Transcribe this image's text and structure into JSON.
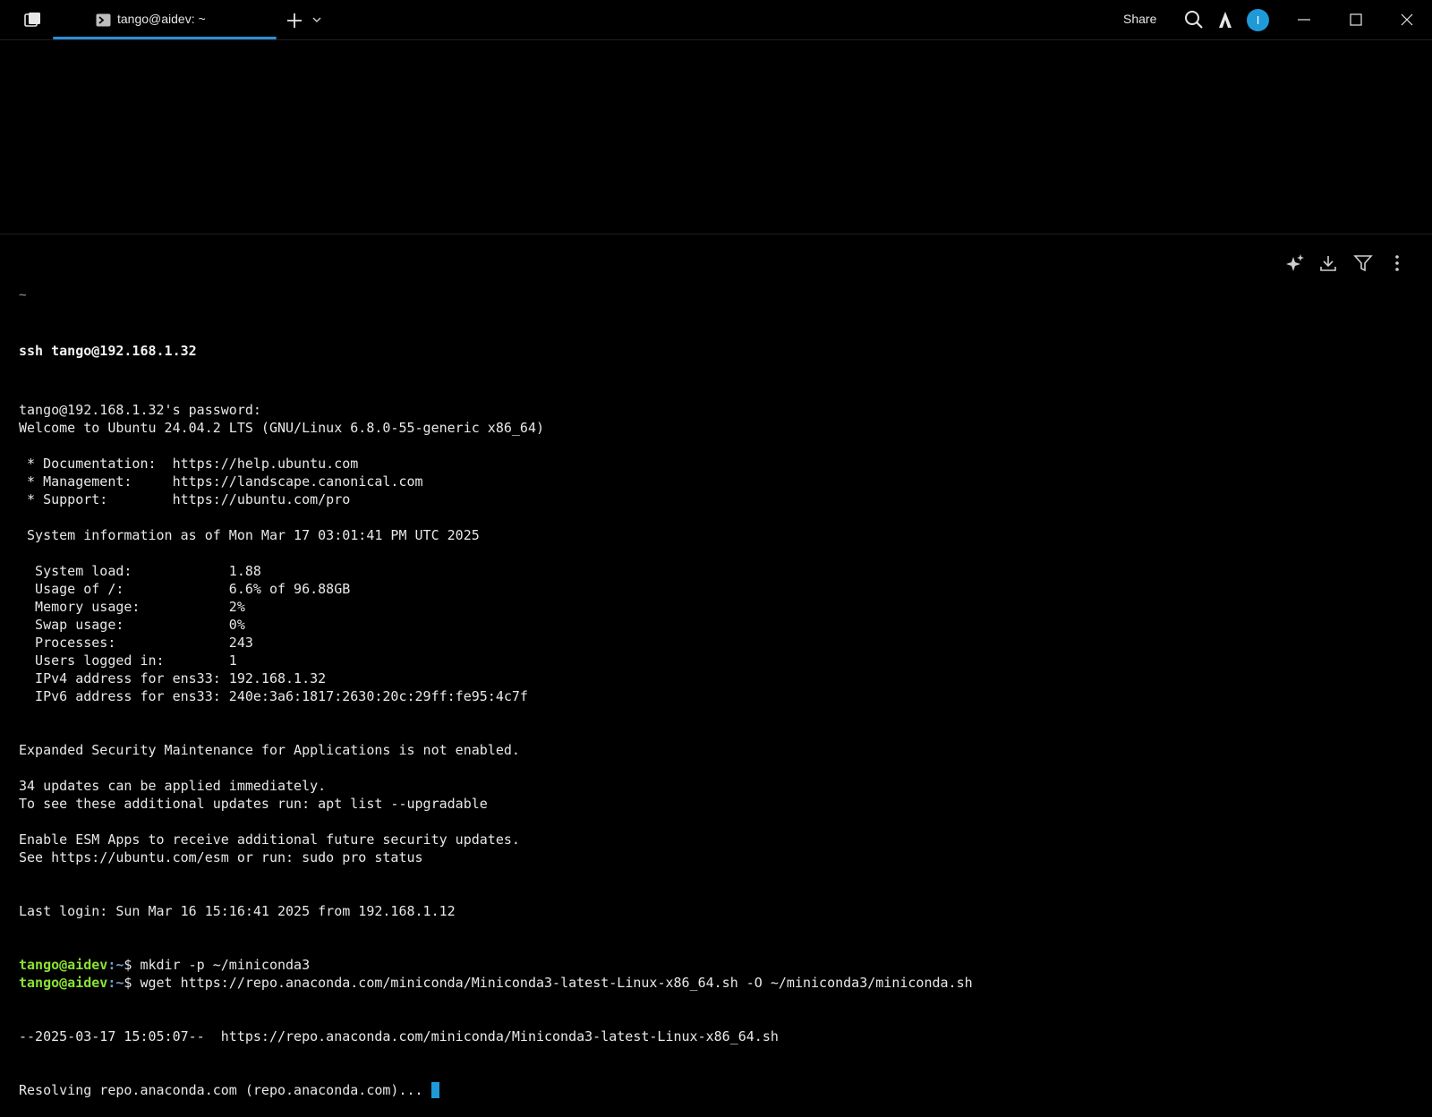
{
  "titlebar": {
    "tab_title": "tango@aidev: ~",
    "share_label": "Share",
    "avatar_letter": "I",
    "accent": "#2a8fd8"
  },
  "block": {
    "directory": "~",
    "command": "ssh tango@192.168.1.32"
  },
  "output": [
    "tango@192.168.1.32's password:",
    "Welcome to Ubuntu 24.04.2 LTS (GNU/Linux 6.8.0-55-generic x86_64)",
    "",
    " * Documentation:  https://help.ubuntu.com",
    " * Management:     https://landscape.canonical.com",
    " * Support:        https://ubuntu.com/pro",
    "",
    " System information as of Mon Mar 17 03:01:41 PM UTC 2025",
    "",
    "  System load:            1.88",
    "  Usage of /:             6.6% of 96.88GB",
    "  Memory usage:           2%",
    "  Swap usage:             0%",
    "  Processes:              243",
    "  Users logged in:        1",
    "  IPv4 address for ens33: 192.168.1.32",
    "  IPv6 address for ens33: 240e:3a6:1817:2630:20c:29ff:fe95:4c7f",
    "",
    "",
    "Expanded Security Maintenance for Applications is not enabled.",
    "",
    "34 updates can be applied immediately.",
    "To see these additional updates run: apt list --upgradable",
    "",
    "Enable ESM Apps to receive additional future security updates.",
    "See https://ubuntu.com/esm or run: sudo pro status",
    "",
    "",
    "Last login: Sun Mar 16 15:16:41 2025 from 192.168.1.12"
  ],
  "prompts": [
    {
      "user": "tango@aidev",
      "path": ":~",
      "symbol": "$ ",
      "command": "mkdir -p ~/miniconda3"
    },
    {
      "user": "tango@aidev",
      "path": ":~",
      "symbol": "$ ",
      "command": "wget https://repo.anaconda.com/miniconda/Miniconda3-latest-Linux-x86_64.sh -O ~/miniconda3/miniconda.sh"
    }
  ],
  "wget_output": [
    "--2025-03-17 15:05:07--  https://repo.anaconda.com/miniconda/Miniconda3-latest-Linux-x86_64.sh",
    "Resolving repo.anaconda.com (repo.anaconda.com)... "
  ],
  "icons": {
    "app": "warp-logo-icon",
    "tab": "terminal-icon",
    "new_tab": "plus-icon",
    "tab_menu": "chevron-down-icon",
    "search": "search-icon",
    "agent": "warp-ai-icon",
    "minimize": "minimize-icon",
    "maximize": "maximize-icon",
    "close": "close-icon",
    "ai_block": "sparkle-icon",
    "download": "download-icon",
    "filter": "filter-icon",
    "more": "more-vertical-icon"
  }
}
